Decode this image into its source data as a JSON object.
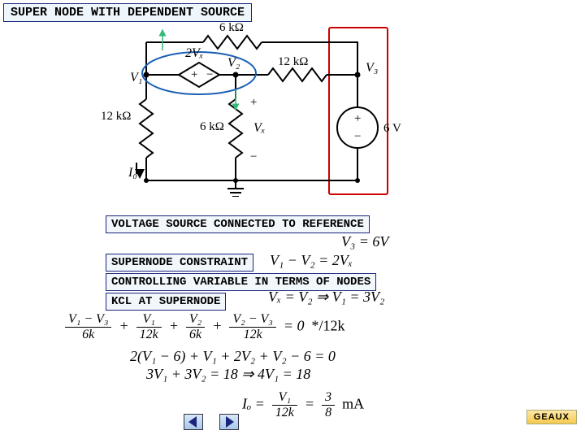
{
  "title": "SUPER NODE WITH DEPENDENT SOURCE",
  "captions": {
    "voltage_ref": "VOLTAGE SOURCE CONNECTED TO REFERENCE",
    "supernode_constraint": "SUPERNODE CONSTRAINT",
    "controlling_var": "CONTROLLING VARIABLE IN TERMS OF NODES",
    "kcl": "KCL AT SUPERNODE"
  },
  "circuit_labels": {
    "r_top": "6 kΩ",
    "r_right": "12 kΩ",
    "r_left": "12 kΩ",
    "r_mid": "6 kΩ",
    "dep_src": "2Vₓ",
    "v1": "V₁",
    "v2": "V₂",
    "v3": "V₃",
    "vx": "Vₓ",
    "io": "I₀",
    "indep_src": "6 V",
    "plus": "+",
    "minus": "−"
  },
  "equations": {
    "e1": "V₃ = 6V",
    "e2": "V₁ − V₂ = 2Vₓ",
    "e3": "Vₓ = V₂ ⇒ V₁ = 3V₂",
    "kcl_note": "*/12k",
    "kcl2": "2(V₁ − 6) + V₁ + 2V₂ + V₂ − 6 = 0",
    "kcl3": "3V₁ + 3V₂ = 18 ⇒ 4V₁ = 18",
    "io_val": "mA",
    "io_frac_n": "3",
    "io_frac_d": "8",
    "io_left": "Iₒ =",
    "io_mid_n": "V₁",
    "io_mid_d": "12k",
    "kcl_t1n": "V₁ − V₃",
    "kcl_t1d": "6k",
    "kcl_t2n": "V₁",
    "kcl_t2d": "12k",
    "kcl_t3n": "V₂",
    "kcl_t3d": "6k",
    "kcl_t4n": "V₂ − V₃",
    "kcl_t4d": "12k"
  },
  "brand": "GEAUX"
}
